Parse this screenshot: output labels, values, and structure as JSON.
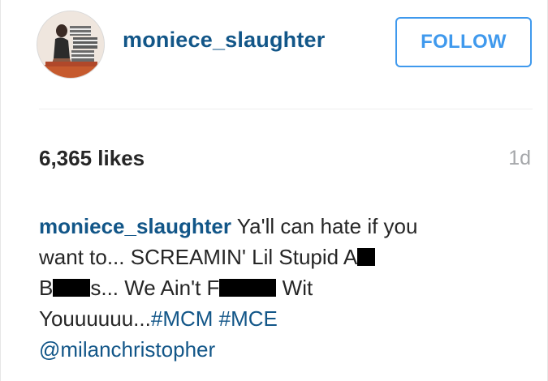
{
  "post": {
    "username": "moniece_slaughter",
    "follow_label": "FOLLOW",
    "likes": "6,365 likes",
    "time_ago": "1d",
    "caption": {
      "username": "moniece_slaughter",
      "line1": " Ya'll can hate if you",
      "line2": "want to... SCREAMIN' Lil Stupid A",
      "line3_a": "B",
      "line3_b": "s... We Ain't F",
      "line3_c": " Wit",
      "line4_text": "Youuuuuu...",
      "hashtag1": "#MCM",
      "hashtag2": "#MCE",
      "mention": "@milanchristopher"
    }
  },
  "colors": {
    "link": "#125688",
    "follow": "#3f99ed",
    "muted": "#a5a7aa",
    "text": "#262626"
  },
  "icons": {
    "avatar": "profile-photo"
  }
}
